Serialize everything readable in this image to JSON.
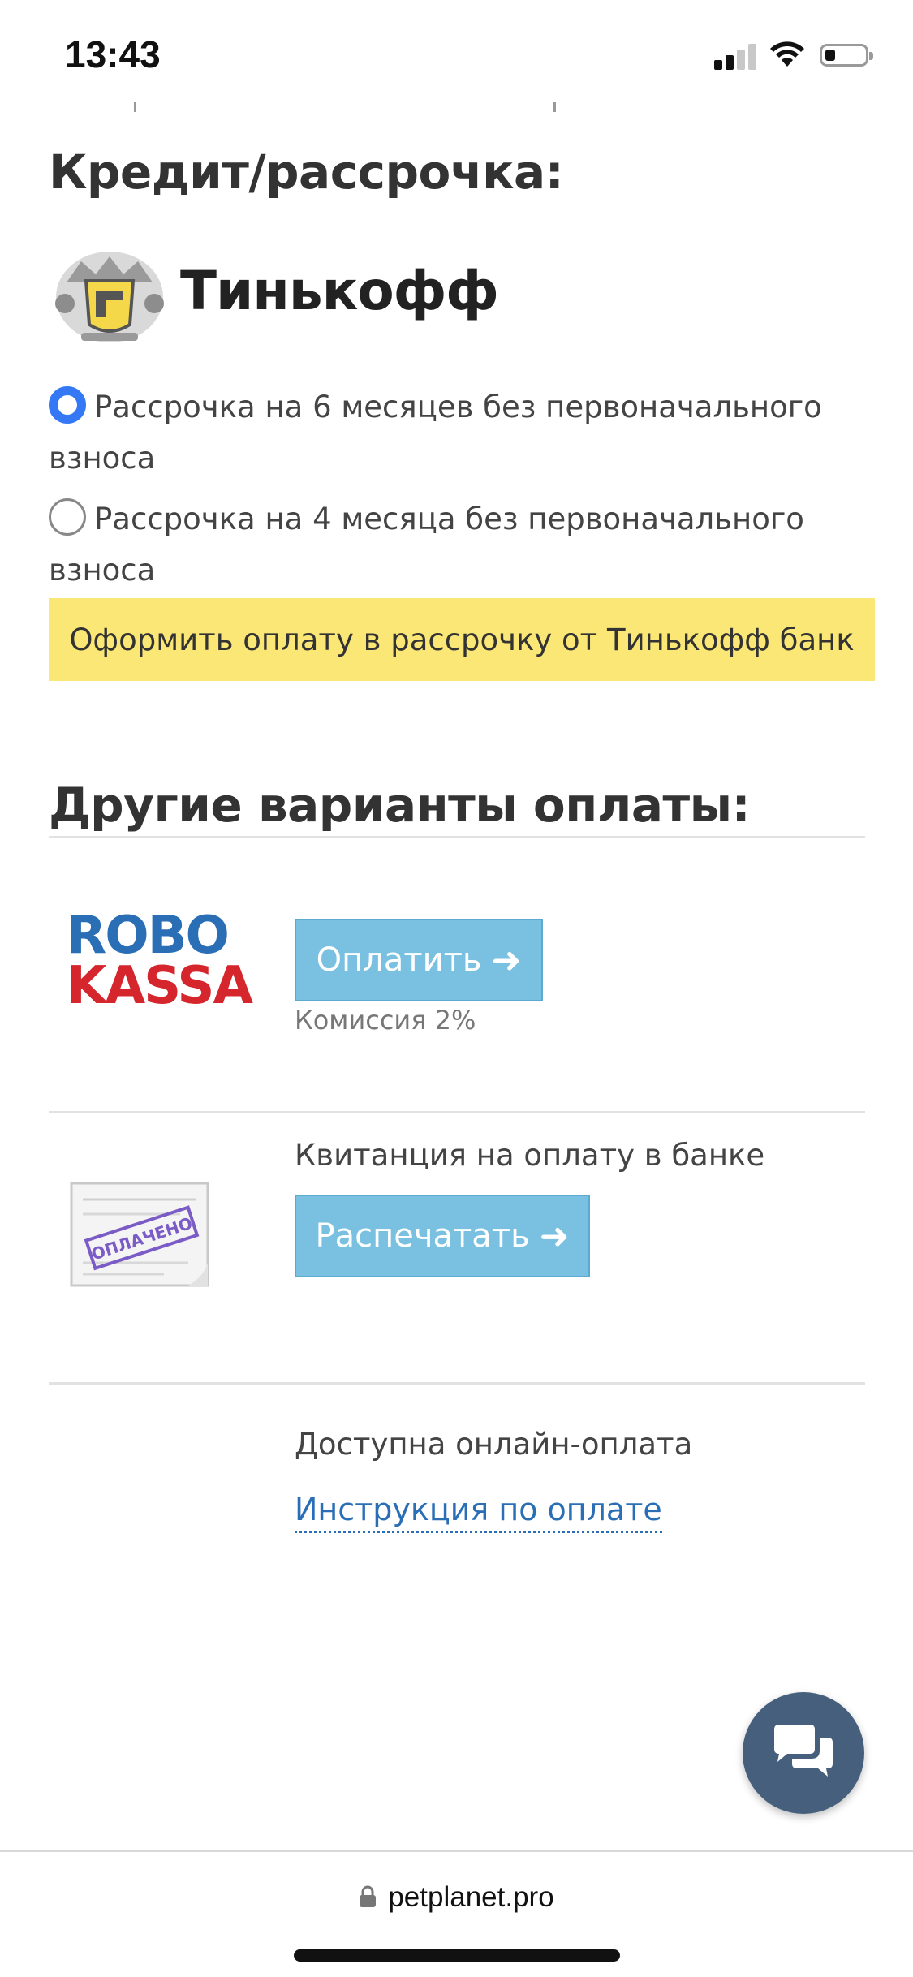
{
  "status_bar": {
    "time": "13:43"
  },
  "credit_section": {
    "heading": "Кредит/рассрочка:",
    "bank_logo_text": "Тинькофф",
    "options": [
      {
        "label": "Рассрочка на 6 месяцев без первоначального взноса",
        "selected": true
      },
      {
        "label": "Рассрочка на 4 месяца без первоначального взноса",
        "selected": false
      }
    ],
    "submit_label": "Оформить оплату в рассрочку от Тинькофф банк",
    "submit_color": "#fbe775"
  },
  "other_section": {
    "heading": "Другие варианты оплаты:",
    "robokassa": {
      "logo_line1": "ROBO",
      "logo_line2": "KASSA",
      "button_label": "Оплатить",
      "fee_note": "Комиссия 2%"
    },
    "receipt": {
      "title": "Квитанция на оплату в банке",
      "stamp_text": "ОПЛАЧЕНО",
      "button_label": "Распечатать"
    },
    "online": {
      "title": "Доступна онлайн-оплата",
      "link_label": "Инструкция по оплате"
    },
    "button_color": "#7ac0e0",
    "link_color": "#2a6fb6"
  },
  "browser": {
    "url": "petplanet.pro"
  }
}
